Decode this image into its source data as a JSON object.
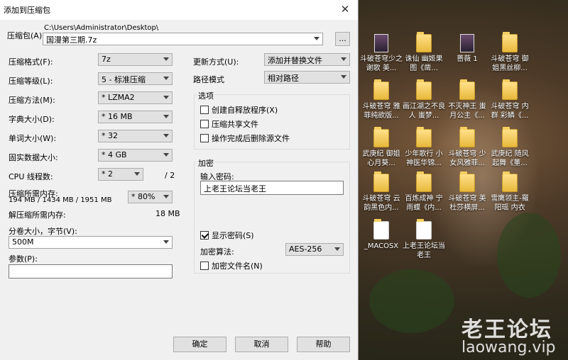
{
  "dialog": {
    "title": "添加到压缩包",
    "archive_label": "压缩包(A)",
    "path": "C:\\Users\\Administrator\\Desktop\\",
    "archive_name": "国漫第三期.7z",
    "browse_label": "...",
    "format_label": "压缩格式(F):",
    "format_value": "7z",
    "level_label": "压缩等级(L):",
    "level_value": "5 - 标准压缩",
    "method_label": "压缩方法(M):",
    "method_value": "* LZMA2",
    "dict_label": "字典大小(D):",
    "dict_value": "* 16 MB",
    "word_label": "单词大小(W):",
    "word_value": "* 32",
    "solid_label": "固实数据大小:",
    "solid_value": "* 4 GB",
    "threads_label": "CPU 线程数:",
    "threads_value": "* 2",
    "threads_max": "/ 2",
    "mem_label": "压缩所需内存:",
    "mem_value": "194 MB / 1434 MB / 1951 MB",
    "mem_percent": "* 80%",
    "decomp_label": "解压缩所需内存:",
    "decomp_value": "18 MB",
    "split_label": "分卷大小，字节(V):",
    "split_value": "500M",
    "params_label": "参数(P):",
    "params_value": "",
    "update_label": "更新方式(U):",
    "update_value": "添加并替换文件",
    "pathmode_label": "路径模式",
    "pathmode_value": "相对路径",
    "options_title": "选项",
    "opt_sfx": "创建自释放程序(X)",
    "opt_shared": "压缩共享文件",
    "opt_delete": "操作完成后删除源文件",
    "enc_title": "加密",
    "password_label": "输入密码:",
    "password_value": "上老王论坛当老王",
    "show_password": "显示密码(S)",
    "enc_method_label": "加密算法:",
    "enc_method_value": "AES-256",
    "enc_names": "加密文件名(N)",
    "ok": "确定",
    "cancel": "取消",
    "help": "帮助"
  },
  "desktop": {
    "icons": [
      "斗破苍穹少之谢歌 美...",
      "诛仙 幽姬果图《凿...",
      "蔷薇 1",
      "斗破苍穹 御姐黑丝柳...",
      "斗破苍穹 雅菲纯欲版...",
      "画江湖之不良人 蚩梦...",
      "不灭神王 蚩月公主《...",
      "斗破苍穹 内群 彩鳞《...",
      "武庚纪 御姐 心月葵...",
      "少年歌行 小神医华锦...",
      "斗破苍穹 少女风雅菲...",
      "武庚纪 随风起舞《董...",
      "斗破苍穹 云韵黑色内...",
      "百炼成神 宁雨蝶《内...",
      "斗破苍穹 美杜莎横屏...",
      "雪鹰领主-羅阳瑶 内衣",
      "_MACOSX",
      "上老王论坛当老王"
    ],
    "watermark_cn": "老王论坛",
    "watermark_en": "laowang.vip"
  }
}
